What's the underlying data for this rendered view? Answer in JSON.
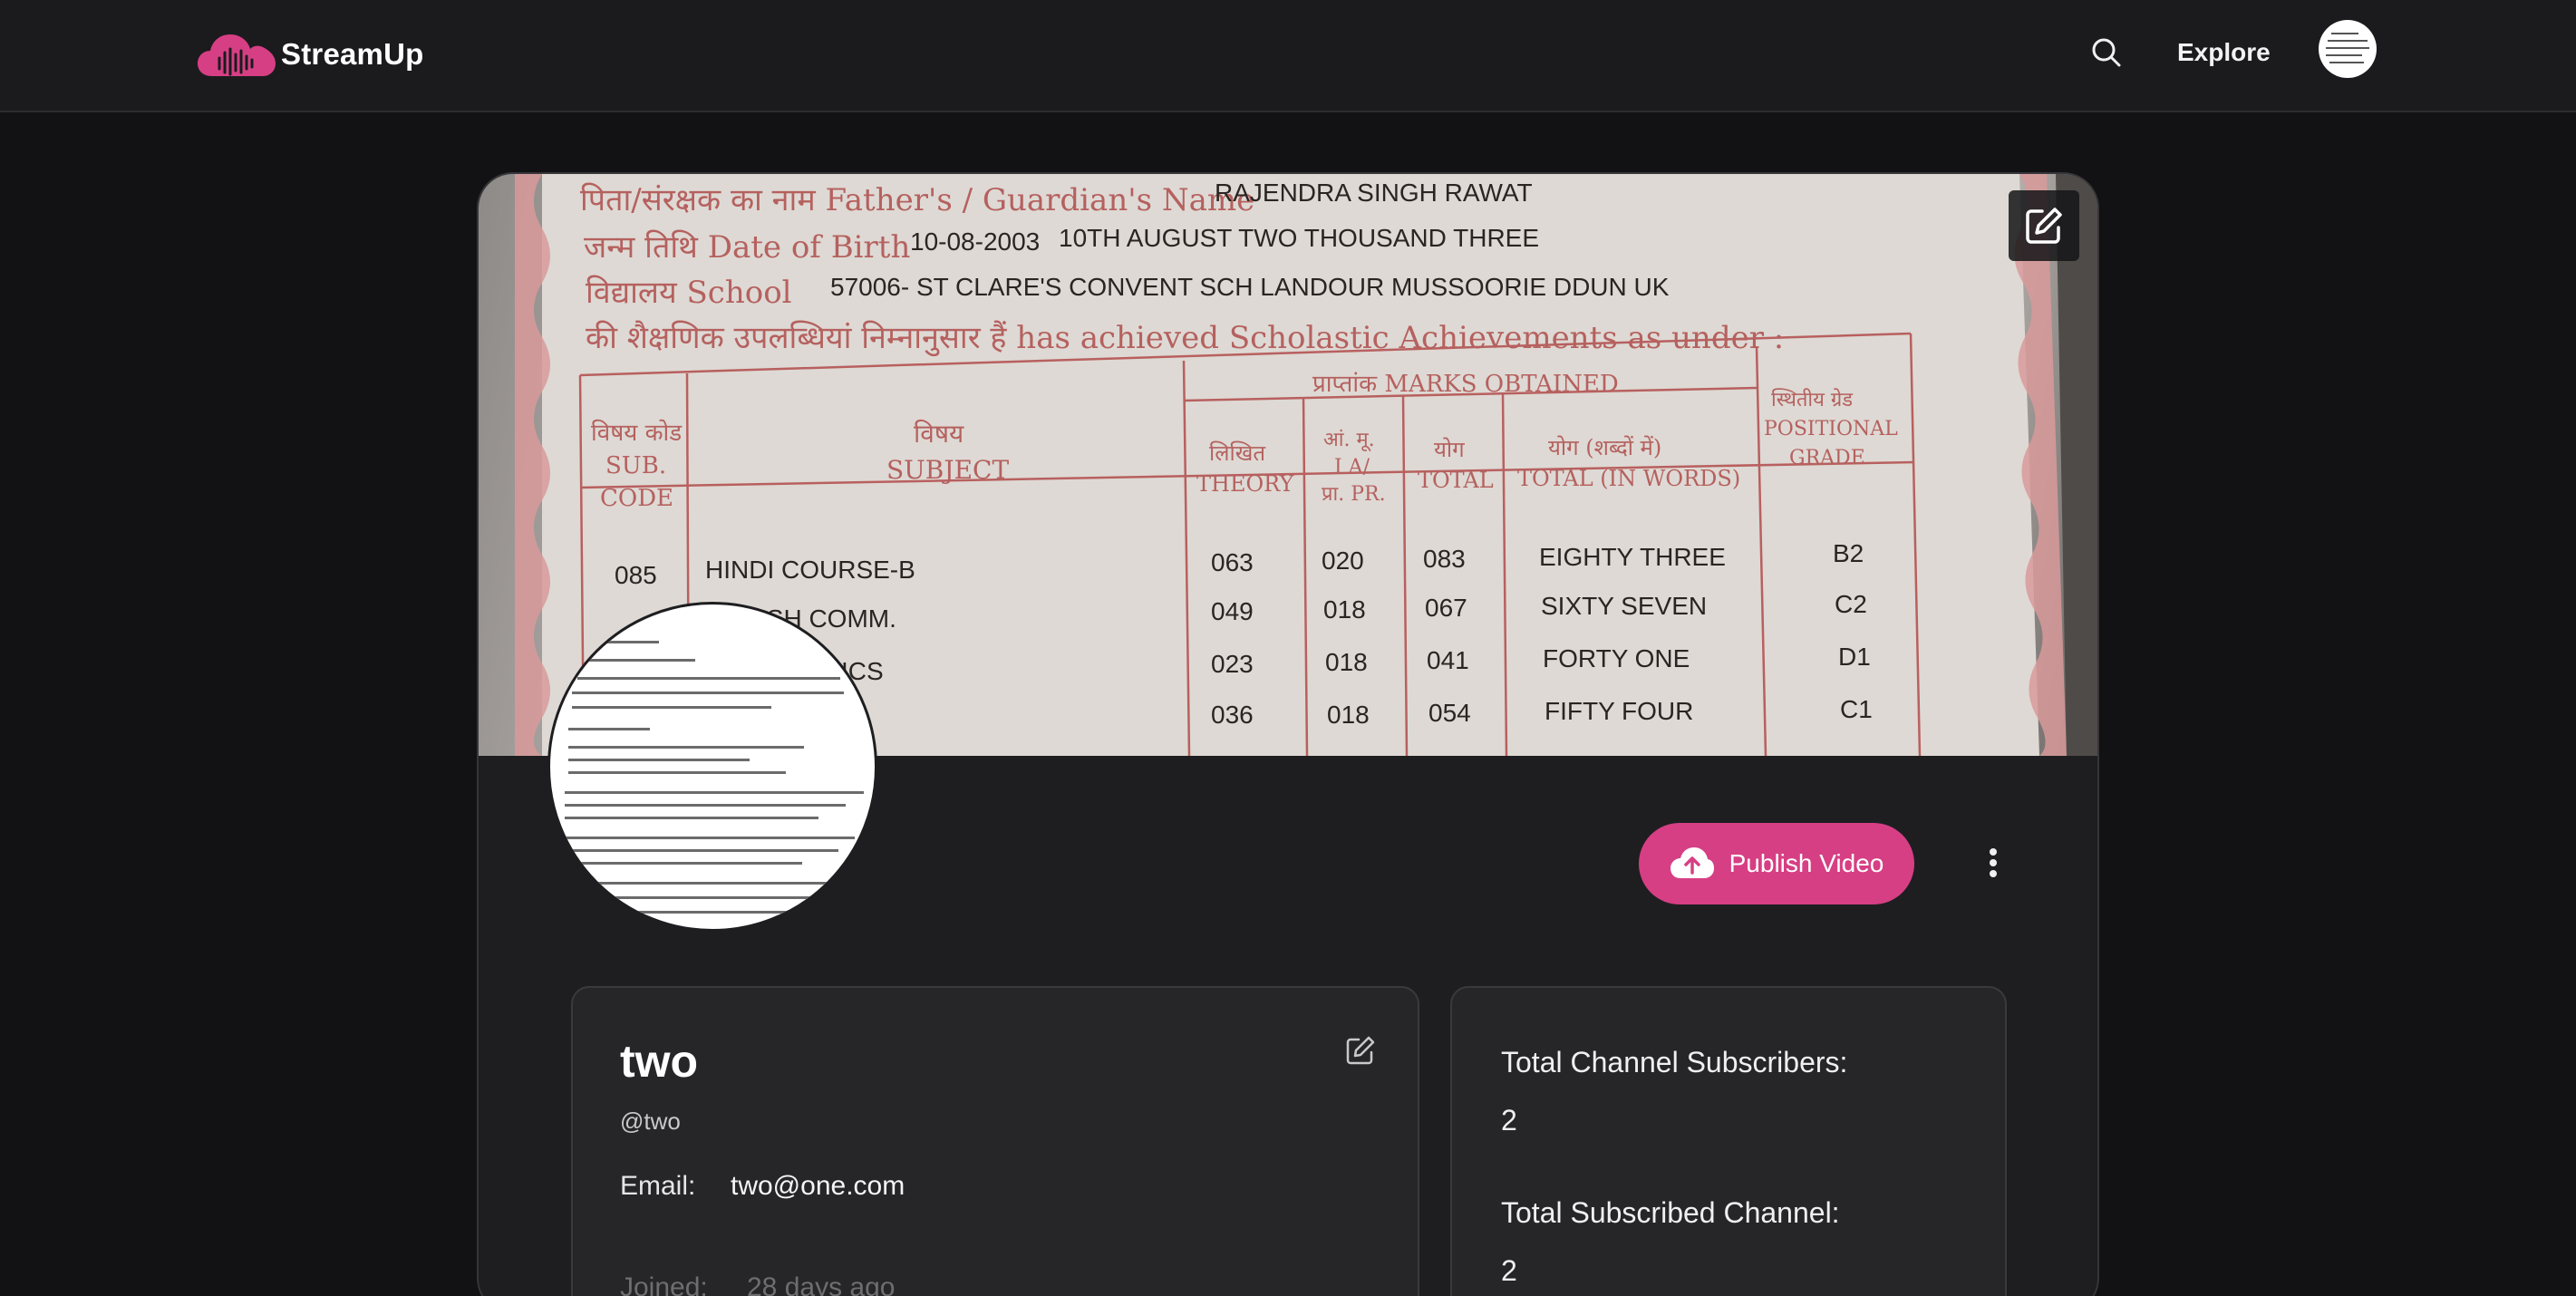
{
  "app": {
    "name": "StreamUp",
    "logo_icon": "cloud-soundwave-icon",
    "brand_color": "#d63f84"
  },
  "nav": {
    "search_icon": "search-icon",
    "explore_label": "Explore"
  },
  "profile": {
    "name": "two",
    "handle": "@two",
    "email_label": "Email:",
    "email": "two@one.com",
    "joined_label": "Joined:",
    "joined": "28 days ago",
    "publish_label": "Publish Video",
    "publish_icon": "cloud-upload-icon",
    "more_icon": "more-vertical-icon",
    "edit_icon": "edit-icon"
  },
  "stats": {
    "subscribers_label": "Total Channel Subscribers:",
    "subscribers_value": "2",
    "subscribed_label": "Total Subscribed Channel:",
    "subscribed_value": "2"
  },
  "cover_photo": {
    "description_lines": [
      "पिता/संरक्षक का नाम Father's / Guardian's Name",
      "RAJENDRA SINGH RAWAT",
      "जन्म तिथि Date of Birth",
      "10-08-2003",
      "10TH AUGUST TWO THOUSAND THREE",
      "विद्यालय School",
      "57006- ST CLARE'S CONVENT SCH LANDOUR MUSSOORIE DDUN UK",
      "की शैक्षणिक उपलब्धियां निम्नानुसार हैं has achieved Scholastic Achievements as under :"
    ],
    "table_headers": {
      "code": [
        "विषय कोड",
        "SUB.",
        "CODE"
      ],
      "subject": [
        "विषय",
        "SUBJECT"
      ],
      "marks": "प्राप्तांक MARKS OBTAINED",
      "theory": [
        "लिखित",
        "THEORY"
      ],
      "ia": [
        "आं. मू.",
        "I A/",
        "प्रा. PR."
      ],
      "total": [
        "योग",
        "TOTAL"
      ],
      "words": [
        "योग (शब्दों में)",
        "TOTAL (IN WORDS)"
      ],
      "grade": [
        "स्थितीय ग्रेड",
        "POSITIONAL",
        "GRADE"
      ]
    },
    "rows": [
      {
        "code": "085",
        "subject": "HINDI COURSE-B",
        "theory": "063",
        "ia": "020",
        "total": "083",
        "words": "EIGHTY THREE",
        "grade": "B2"
      },
      {
        "code": "",
        "subject": "ISH COMM.",
        "theory": "049",
        "ia": "018",
        "total": "067",
        "words": "SIXTY SEVEN",
        "grade": "C2"
      },
      {
        "code": "",
        "subject": "ICS",
        "theory": "023",
        "ia": "018",
        "total": "041",
        "words": "FORTY ONE",
        "grade": "D1"
      },
      {
        "code": "",
        "subject": "",
        "theory": "036",
        "ia": "018",
        "total": "054",
        "words": "FIFTY FOUR",
        "grade": "C1"
      }
    ]
  }
}
